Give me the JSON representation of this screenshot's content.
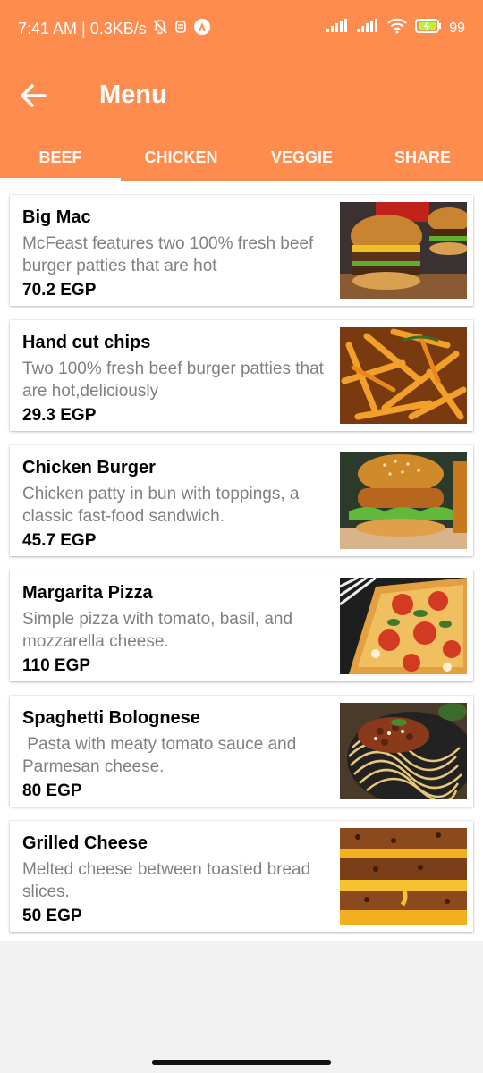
{
  "status": {
    "time": "7:41 AM | 0.3KB/s",
    "battery": "99"
  },
  "toolbar": {
    "title": "Menu"
  },
  "tabs": [
    {
      "label": "BEEF",
      "active": true
    },
    {
      "label": "CHICKEN",
      "active": false
    },
    {
      "label": "VEGGIE",
      "active": false
    },
    {
      "label": "SHARE",
      "active": false
    }
  ],
  "items": [
    {
      "name": "Big Mac",
      "description": "McFeast features two 100% fresh beef burger patties that are hot",
      "price": "70.2 EGP",
      "image_icon": "burger-image"
    },
    {
      "name": "Hand cut chips",
      "description": "Two 100% fresh beef burger patties that are hot,deliciously",
      "price": "29.3 EGP",
      "image_icon": "fries-image"
    },
    {
      "name": "Chicken Burger",
      "description": "Chicken patty in bun with toppings, a classic fast-food sandwich.",
      "price": "45.7 EGP",
      "image_icon": "chicken-burger-image"
    },
    {
      "name": "Margarita Pizza",
      "description": "Simple pizza with tomato, basil, and mozzarella cheese.",
      "price": "110 EGP",
      "image_icon": "pizza-image"
    },
    {
      "name": "Spaghetti Bolognese",
      "description": " Pasta with meaty tomato sauce and Parmesan cheese.",
      "price": "80 EGP",
      "image_icon": "spaghetti-image"
    },
    {
      "name": "Grilled Cheese",
      "description": "Melted cheese between toasted bread slices.",
      "price": "50 EGP",
      "image_icon": "grilled-cheese-image"
    }
  ],
  "colors": {
    "accent": "#ff8c4f",
    "text_secondary": "#808080"
  }
}
